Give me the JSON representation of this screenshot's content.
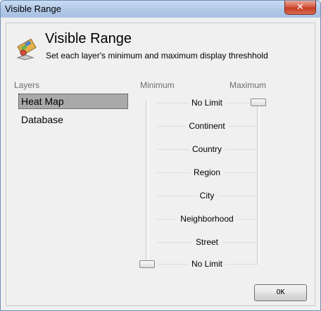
{
  "window": {
    "title": "Visible Range",
    "close_glyph": "✕"
  },
  "header": {
    "icon": "layers-range-icon",
    "title": "Visible Range",
    "subtitle": "Set each layer's minimum and maximum display threshhold"
  },
  "layers": {
    "label": "Layers",
    "items": [
      {
        "label": "Heat Map",
        "selected": true
      },
      {
        "label": "Database",
        "selected": false
      }
    ]
  },
  "range": {
    "min_label": "Minimum",
    "max_label": "Maximum",
    "levels": [
      "No Limit",
      "Continent",
      "Country",
      "Region",
      "City",
      "Neighborhood",
      "Street",
      "No Limit"
    ],
    "minimum_value": "No Limit",
    "maximum_value": "No Limit"
  },
  "buttons": {
    "ok": "OK"
  },
  "colors": {
    "titlebar": "#b3cae8",
    "close": "#c94a33",
    "selection": "#a9a9a9"
  }
}
